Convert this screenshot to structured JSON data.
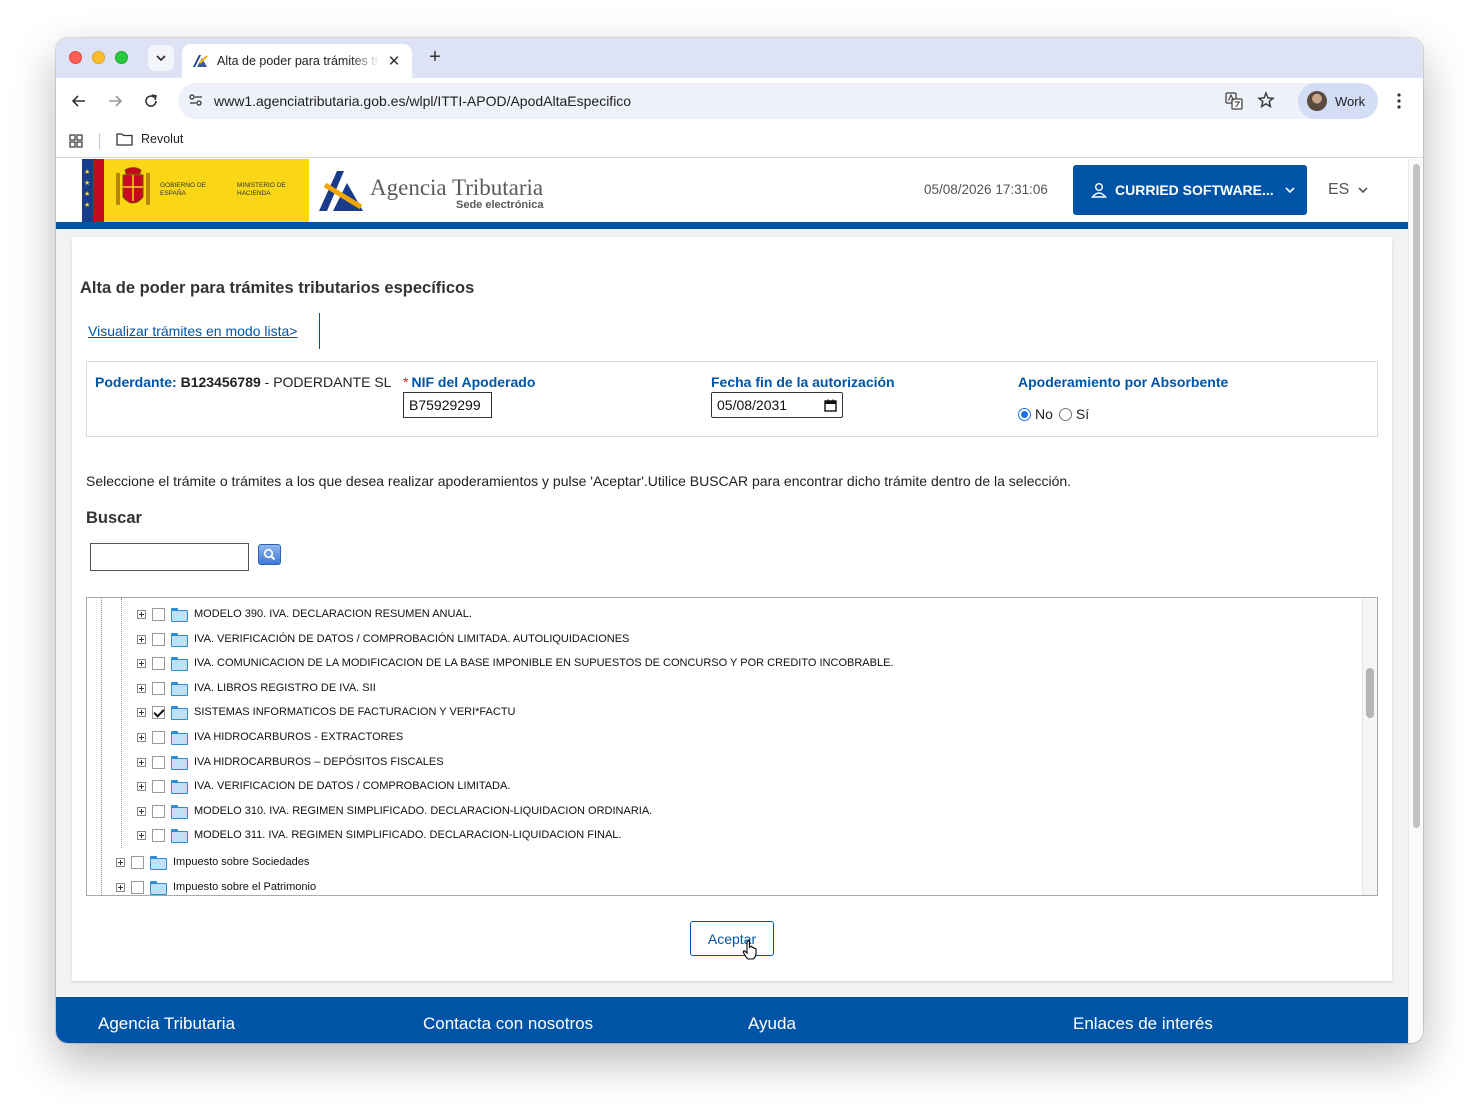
{
  "browser": {
    "tab_title": "Alta de poder para trámites tributarios específicos",
    "new_tab": "+",
    "close_tab": "✕",
    "url_host": "www1.agenciatributaria.gob.es",
    "url_path": "/wlpl/ITTI-APOD/ApodAltaEspecifico",
    "profile_label": "Work",
    "bookmark_label": "Revolut"
  },
  "header": {
    "gov_text": "GOBIERNO DE ESPAÑA",
    "ministry_text": "MINISTERIO DE HACIENDA",
    "brand_name": "Agencia Tributaria",
    "brand_sub": "Sede electrónica",
    "datetime": "05/08/2026 17:31:06",
    "user_label": "CURRIED SOFTWARE...",
    "language": "ES"
  },
  "page": {
    "title": "Alta de poder para trámites tributarios específicos",
    "list_link": "Visualizar trámites en modo lista>",
    "poderdante_label": "Poderdante:",
    "poderdante_nif": "B123456789",
    "poderdante_name": "- PODERDANTE SL",
    "nif_label": "NIF del Apoderado",
    "nif_required_mark": "*",
    "nif_value": "B75929299",
    "fecha_label": "Fecha fin de la autorización",
    "fecha_value": "05/08/2031",
    "absorbente_label": "Apoderamiento por Absorbente",
    "radio_no": "No",
    "radio_si": "Sí",
    "instructions": "Seleccione el trámite o trámites a los que desea realizar apoderamientos y pulse 'Aceptar'.Utilice BUSCAR para encontrar dicho trámite dentro de la selección.",
    "search_title": "Buscar",
    "search_value": "",
    "accept_label": "Aceptar"
  },
  "tree": {
    "items": [
      {
        "label": "MODELO 390. IVA. DECLARACION RESUMEN ANUAL.",
        "checked": false,
        "level": 2
      },
      {
        "label": "IVA. VERIFICACIÓN DE DATOS / COMPROBACIÓN LIMITADA. AUTOLIQUIDACIONES",
        "checked": false,
        "level": 2
      },
      {
        "label": "IVA. COMUNICACION DE LA MODIFICACION DE LA BASE IMPONIBLE EN SUPUESTOS DE CONCURSO Y POR CREDITO INCOBRABLE.",
        "checked": false,
        "level": 2
      },
      {
        "label": "IVA. LIBROS REGISTRO DE IVA. SII",
        "checked": false,
        "level": 2
      },
      {
        "label": "SISTEMAS INFORMATICOS DE FACTURACION Y VERI*FACTU",
        "checked": true,
        "level": 2
      },
      {
        "label": "IVA HIDROCARBUROS - EXTRACTORES",
        "checked": false,
        "level": 2
      },
      {
        "label": "IVA HIDROCARBUROS – DEPÓSITOS FISCALES",
        "checked": false,
        "level": 2
      },
      {
        "label": "IVA. VERIFICACION DE DATOS / COMPROBACION LIMITADA.",
        "checked": false,
        "level": 2
      },
      {
        "label": "MODELO 310. IVA. REGIMEN SIMPLIFICADO. DECLARACION-LIQUIDACION ORDINARIA.",
        "checked": false,
        "level": 2
      },
      {
        "label": "MODELO 311. IVA. REGIMEN SIMPLIFICADO. DECLARACION-LIQUIDACION FINAL.",
        "checked": false,
        "level": 2
      },
      {
        "label": "Impuesto sobre Sociedades",
        "checked": false,
        "level": 1
      },
      {
        "label": "Impuesto sobre el Patrimonio",
        "checked": false,
        "level": 1
      }
    ]
  },
  "footer": {
    "links": [
      "Agencia Tributaria",
      "Contacta con nosotros",
      "Ayuda",
      "Enlaces de interés"
    ]
  },
  "colors": {
    "brand_blue": "#0054a8",
    "gov_yellow": "#f9d616"
  }
}
